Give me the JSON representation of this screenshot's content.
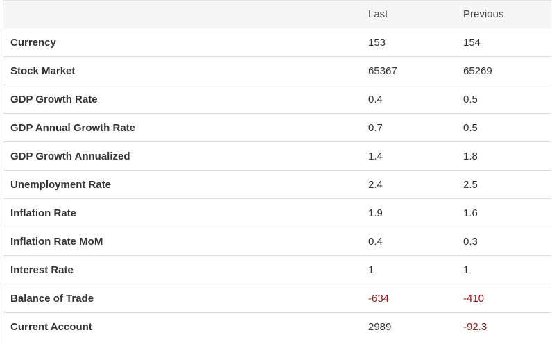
{
  "header": {
    "name": "",
    "last": "Last",
    "previous": "Previous"
  },
  "rows": [
    {
      "name": "Currency",
      "last": "153",
      "previous": "154"
    },
    {
      "name": "Stock Market",
      "last": "65367",
      "previous": "65269"
    },
    {
      "name": "GDP Growth Rate",
      "last": "0.4",
      "previous": "0.5"
    },
    {
      "name": "GDP Annual Growth Rate",
      "last": "0.7",
      "previous": "0.5"
    },
    {
      "name": "GDP Growth Annualized",
      "last": "1.4",
      "previous": "1.8"
    },
    {
      "name": "Unemployment Rate",
      "last": "2.4",
      "previous": "2.5"
    },
    {
      "name": "Inflation Rate",
      "last": "1.9",
      "previous": "1.6"
    },
    {
      "name": "Inflation Rate MoM",
      "last": "0.4",
      "previous": "0.3"
    },
    {
      "name": "Interest Rate",
      "last": "1",
      "previous": "1"
    },
    {
      "name": "Balance of Trade",
      "last": "-634",
      "previous": "-410"
    },
    {
      "name": "Current Account",
      "last": "2989",
      "previous": "-92.3"
    }
  ],
  "colors": {
    "negative": "#8b1a1a",
    "text": "#333333",
    "header_bg": "#f5f5f5",
    "border": "#dddddd"
  }
}
